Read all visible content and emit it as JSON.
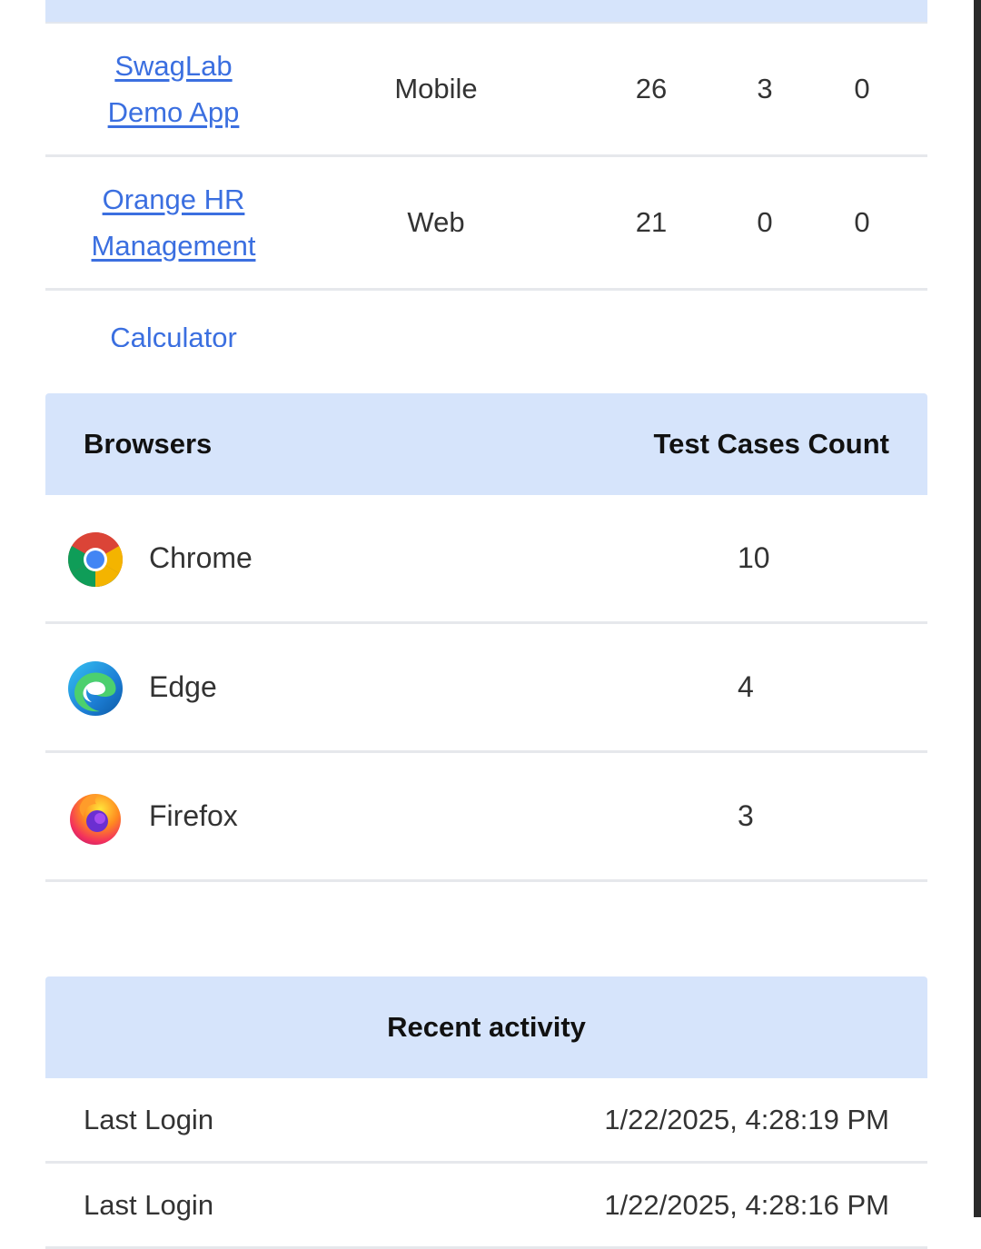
{
  "projects": {
    "rows": [
      {
        "name_line1": "SwagLab",
        "name_line2": "Demo App",
        "type": "Mobile",
        "n1": "26",
        "n2": "3",
        "n3": "0"
      },
      {
        "name_line1": "Orange HR",
        "name_line2": "Management",
        "type": "Web",
        "n1": "21",
        "n2": "0",
        "n3": "0"
      },
      {
        "name_line1": "Calculator",
        "name_line2": "",
        "type": "",
        "n1": "",
        "n2": "",
        "n3": ""
      }
    ]
  },
  "browsers": {
    "header_left": "Browsers",
    "header_right": "Test Cases Count",
    "rows": [
      {
        "name": "Chrome",
        "count": "10",
        "icon": "chrome-icon"
      },
      {
        "name": "Edge",
        "count": "4",
        "icon": "edge-icon"
      },
      {
        "name": "Firefox",
        "count": "3",
        "icon": "firefox-icon"
      }
    ]
  },
  "activity": {
    "title": "Recent activity",
    "rows": [
      {
        "label": "Last Login",
        "value": "1/22/2025, 4:28:19 PM"
      },
      {
        "label": "Last Login",
        "value": "1/22/2025, 4:28:16 PM"
      }
    ]
  },
  "colors": {
    "header_bg": "#d6e4fb",
    "link": "#3b6fe0",
    "divider": "#e6e8ec"
  }
}
